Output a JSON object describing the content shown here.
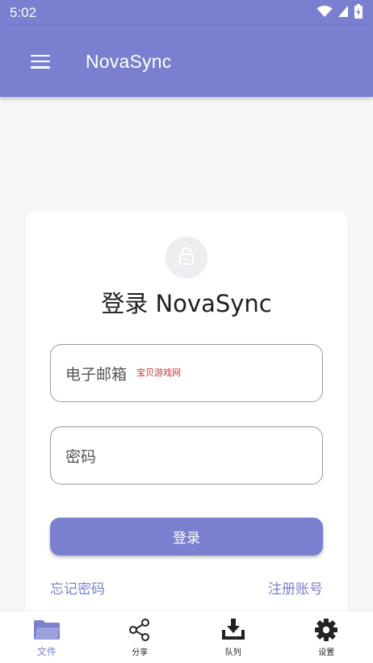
{
  "status_bar": {
    "time": "5:02",
    "icons": [
      "wifi-icon",
      "signal-icon",
      "battery-icon"
    ]
  },
  "app_bar": {
    "title": "NovaSync",
    "menu_icon": "menu-icon"
  },
  "login_card": {
    "lock_icon": "lock-icon",
    "title": "登录 NovaSync",
    "email_label": "电子邮箱",
    "watermark": "宝贝游戏网",
    "password_label": "密码",
    "login_button": "登录",
    "forgot_password": "忘记密码",
    "register": "注册账号"
  },
  "bottom_nav": {
    "items": [
      {
        "label": "文件",
        "icon": "folder-icon",
        "active": true
      },
      {
        "label": "分享",
        "icon": "share-icon",
        "active": false
      },
      {
        "label": "队列",
        "icon": "download-icon",
        "active": false
      },
      {
        "label": "设置",
        "icon": "gear-icon",
        "active": false
      }
    ]
  },
  "colors": {
    "primary": "#7a80cf",
    "background": "#f7f7f8",
    "card": "#ffffff",
    "watermark": "#d2322d"
  }
}
